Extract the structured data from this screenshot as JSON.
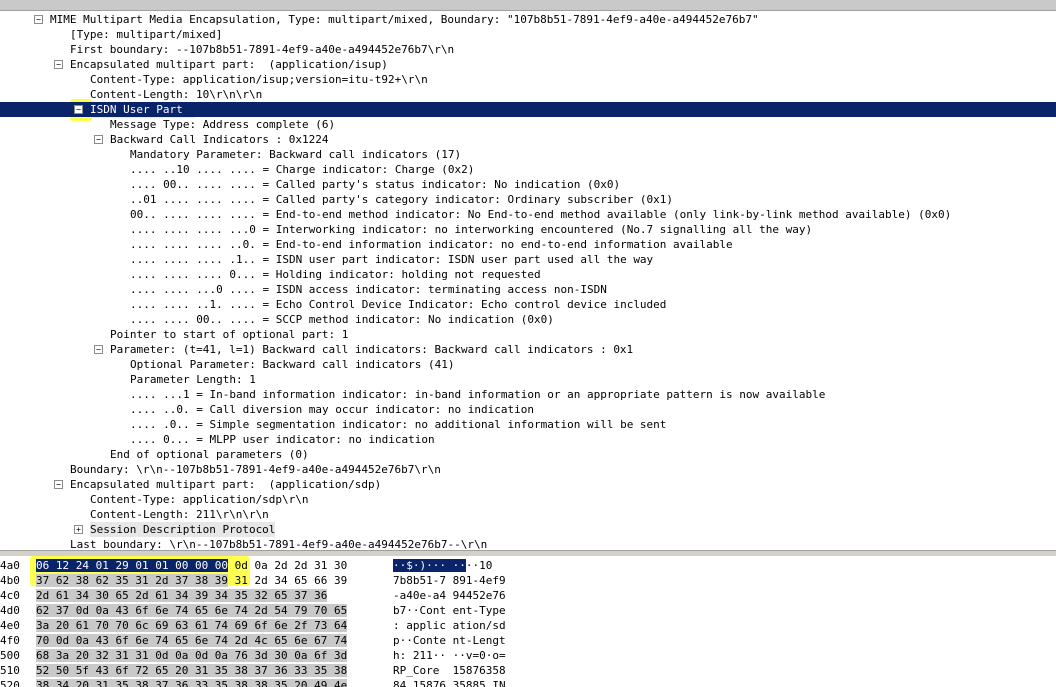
{
  "tree": [
    {
      "t": "MIME Multipart Media Encapsulation, Type: multipart/mixed, Boundary: \"107b8b51-7891-4ef9-a40e-a494452e76b7\"",
      "d": 0,
      "tg": "-"
    },
    {
      "t": "[Type: multipart/mixed]",
      "d": 1
    },
    {
      "t": "First boundary: --107b8b51-7891-4ef9-a40e-a494452e76b7\\r\\n",
      "d": 1
    },
    {
      "t": "Encapsulated multipart part:  (application/isup)",
      "d": 1,
      "tg": "-"
    },
    {
      "t": "Content-Type: application/isup;version=itu-t92+\\r\\n",
      "d": 2
    },
    {
      "t": "Content-Length: 10\\r\\n\\r\\n",
      "d": 2
    },
    {
      "t": "ISDN User Part",
      "d": 2,
      "tg": "-",
      "sel": true
    },
    {
      "t": "Message Type: Address complete (6)",
      "d": 3
    },
    {
      "t": "Backward Call Indicators : 0x1224",
      "d": 3,
      "tg": "-"
    },
    {
      "t": "Mandatory Parameter: Backward call indicators (17)",
      "d": 4
    },
    {
      "t": ".... ..10 .... .... = Charge indicator: Charge (0x2)",
      "d": 4
    },
    {
      "t": ".... 00.. .... .... = Called party's status indicator: No indication (0x0)",
      "d": 4
    },
    {
      "t": "..01 .... .... .... = Called party's category indicator: Ordinary subscriber (0x1)",
      "d": 4
    },
    {
      "t": "00.. .... .... .... = End-to-end method indicator: No End-to-end method available (only link-by-link method available) (0x0)",
      "d": 4
    },
    {
      "t": ".... .... .... ...0 = Interworking indicator: no interworking encountered (No.7 signalling all the way)",
      "d": 4
    },
    {
      "t": ".... .... .... ..0. = End-to-end information indicator: no end-to-end information available",
      "d": 4
    },
    {
      "t": ".... .... .... .1.. = ISDN user part indicator: ISDN user part used all the way",
      "d": 4
    },
    {
      "t": ".... .... .... 0... = Holding indicator: holding not requested",
      "d": 4
    },
    {
      "t": ".... .... ...0 .... = ISDN access indicator: terminating access non-ISDN",
      "d": 4
    },
    {
      "t": ".... .... ..1. .... = Echo Control Device Indicator: Echo control device included",
      "d": 4
    },
    {
      "t": ".... .... 00.. .... = SCCP method indicator: No indication (0x0)",
      "d": 4
    },
    {
      "t": "Pointer to start of optional part: 1",
      "d": 3
    },
    {
      "t": "Parameter: (t=41, l=1) Backward call indicators: Backward call indicators : 0x1",
      "d": 3,
      "tg": "-"
    },
    {
      "t": "Optional Parameter: Backward call indicators (41)",
      "d": 4
    },
    {
      "t": "Parameter Length: 1",
      "d": 4
    },
    {
      "t": ".... ...1 = In-band information indicator: in-band information or an appropriate pattern is now available",
      "d": 4
    },
    {
      "t": ".... ..0. = Call diversion may occur indicator: no indication",
      "d": 4
    },
    {
      "t": ".... .0.. = Simple segmentation indicator: no additional information will be sent",
      "d": 4
    },
    {
      "t": ".... 0... = MLPP user indicator: no indication",
      "d": 4
    },
    {
      "t": "End of optional parameters (0)",
      "d": 3
    },
    {
      "t": "Boundary: \\r\\n--107b8b51-7891-4ef9-a40e-a494452e76b7\\r\\n",
      "d": 1
    },
    {
      "t": "Encapsulated multipart part:  (application/sdp)",
      "d": 1,
      "tg": "-"
    },
    {
      "t": "Content-Type: application/sdp\\r\\n",
      "d": 2
    },
    {
      "t": "Content-Length: 211\\r\\n\\r\\n",
      "d": 2
    },
    {
      "t": "Session Description Protocol",
      "d": 2,
      "tg": "+",
      "shade": true
    },
    {
      "t": "Last boundary: \\r\\n--107b8b51-7891-4ef9-a40e-a494452e76b7--\\r\\n",
      "d": 1
    }
  ],
  "hex": [
    {
      "off": "4a0",
      "b": [
        [
          "06 12 24 01 29 01 01 00 00 00",
          "sel"
        ],
        [
          " 0d 0a 2d 2d 31 30",
          ""
        ]
      ],
      "a": [
        [
          "··$·)··· ··",
          "sel"
        ],
        [
          "··10",
          ""
        ]
      ]
    },
    {
      "off": "4b0",
      "b": [
        [
          "37 62 38 62 35 31 2d 37 38 39",
          "hi"
        ],
        [
          " 31 2d 34 65 66 39",
          ""
        ]
      ],
      "a": [
        [
          "7b8b51-7 891-4ef9",
          ""
        ]
      ]
    },
    {
      "off": "4c0",
      "b": [
        [
          "2d 61 34 30 65 2d 61 34 39 34 35 32 65 37 36",
          "hi"
        ]
      ],
      "a": [
        [
          "-a40e-a4 94452e76",
          ""
        ]
      ]
    },
    {
      "off": "4d0",
      "b": [
        [
          "62 37 0d 0a 43 6f 6e 74 65 6e 74 2d 54 79 70 65",
          "hi"
        ]
      ],
      "a": [
        [
          "b7··Cont ent-Type",
          ""
        ]
      ]
    },
    {
      "off": "4e0",
      "b": [
        [
          "3a 20 61 70 70 6c 69 63 61 74 69 6f 6e 2f 73 64",
          "hi"
        ]
      ],
      "a": [
        [
          ": applic ation/sd",
          ""
        ]
      ]
    },
    {
      "off": "4f0",
      "b": [
        [
          "70 0d 0a 43 6f 6e 74 65 6e 74 2d 4c 65 6e 67 74",
          "hi"
        ]
      ],
      "a": [
        [
          "p··Conte nt-Lengt",
          ""
        ]
      ]
    },
    {
      "off": "500",
      "b": [
        [
          "68 3a 20 32 31 31 0d 0a 0d 0a 76 3d 30 0a 6f 3d",
          "hi"
        ]
      ],
      "a": [
        [
          "h: 211·· ··v=0·o=",
          ""
        ]
      ]
    },
    {
      "off": "510",
      "b": [
        [
          "52 50 5f 43 6f 72 65 20 31 35 38 37 36 33 35 38",
          "hi"
        ]
      ],
      "a": [
        [
          "RP_Core  15876358",
          ""
        ]
      ]
    },
    {
      "off": "520",
      "b": [
        [
          "38 34 20 31 35 38 37 36 33 35 38 38 35 20 49 4e",
          "hi"
        ]
      ],
      "a": [
        [
          "84 15876 35885 IN",
          ""
        ]
      ]
    }
  ]
}
